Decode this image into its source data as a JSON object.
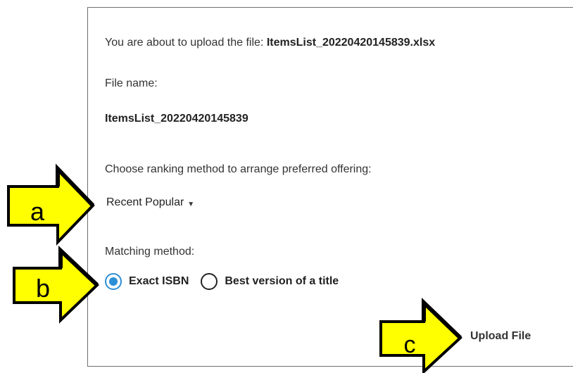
{
  "dialog": {
    "intro_prefix": "You are about to upload the file: ",
    "intro_filename": "ItemsList_20220420145839.xlsx",
    "file_name_label": "File name:",
    "file_name_value": "ItemsList_20220420145839",
    "ranking_label": "Choose ranking method to arrange preferred offering:",
    "ranking_value": "Recent Popular",
    "matching_label": "Matching method:",
    "matching_options": [
      {
        "label": "Exact ISBN",
        "selected": true
      },
      {
        "label": "Best version of a title",
        "selected": false
      }
    ],
    "upload_label": "Upload File"
  },
  "callouts": [
    {
      "label": "a",
      "icon": "arrow-right-icon",
      "target": "ranking-method-dropdown"
    },
    {
      "label": "b",
      "icon": "arrow-right-icon",
      "target": "matching-method-radio"
    },
    {
      "label": "c",
      "icon": "arrow-right-icon",
      "target": "upload-file-button"
    }
  ],
  "colors": {
    "callout_fill": "#ffff00",
    "callout_stroke": "#000000",
    "radio_selected": "#2b8fd6",
    "dialog_border": "#6f6f6f"
  }
}
